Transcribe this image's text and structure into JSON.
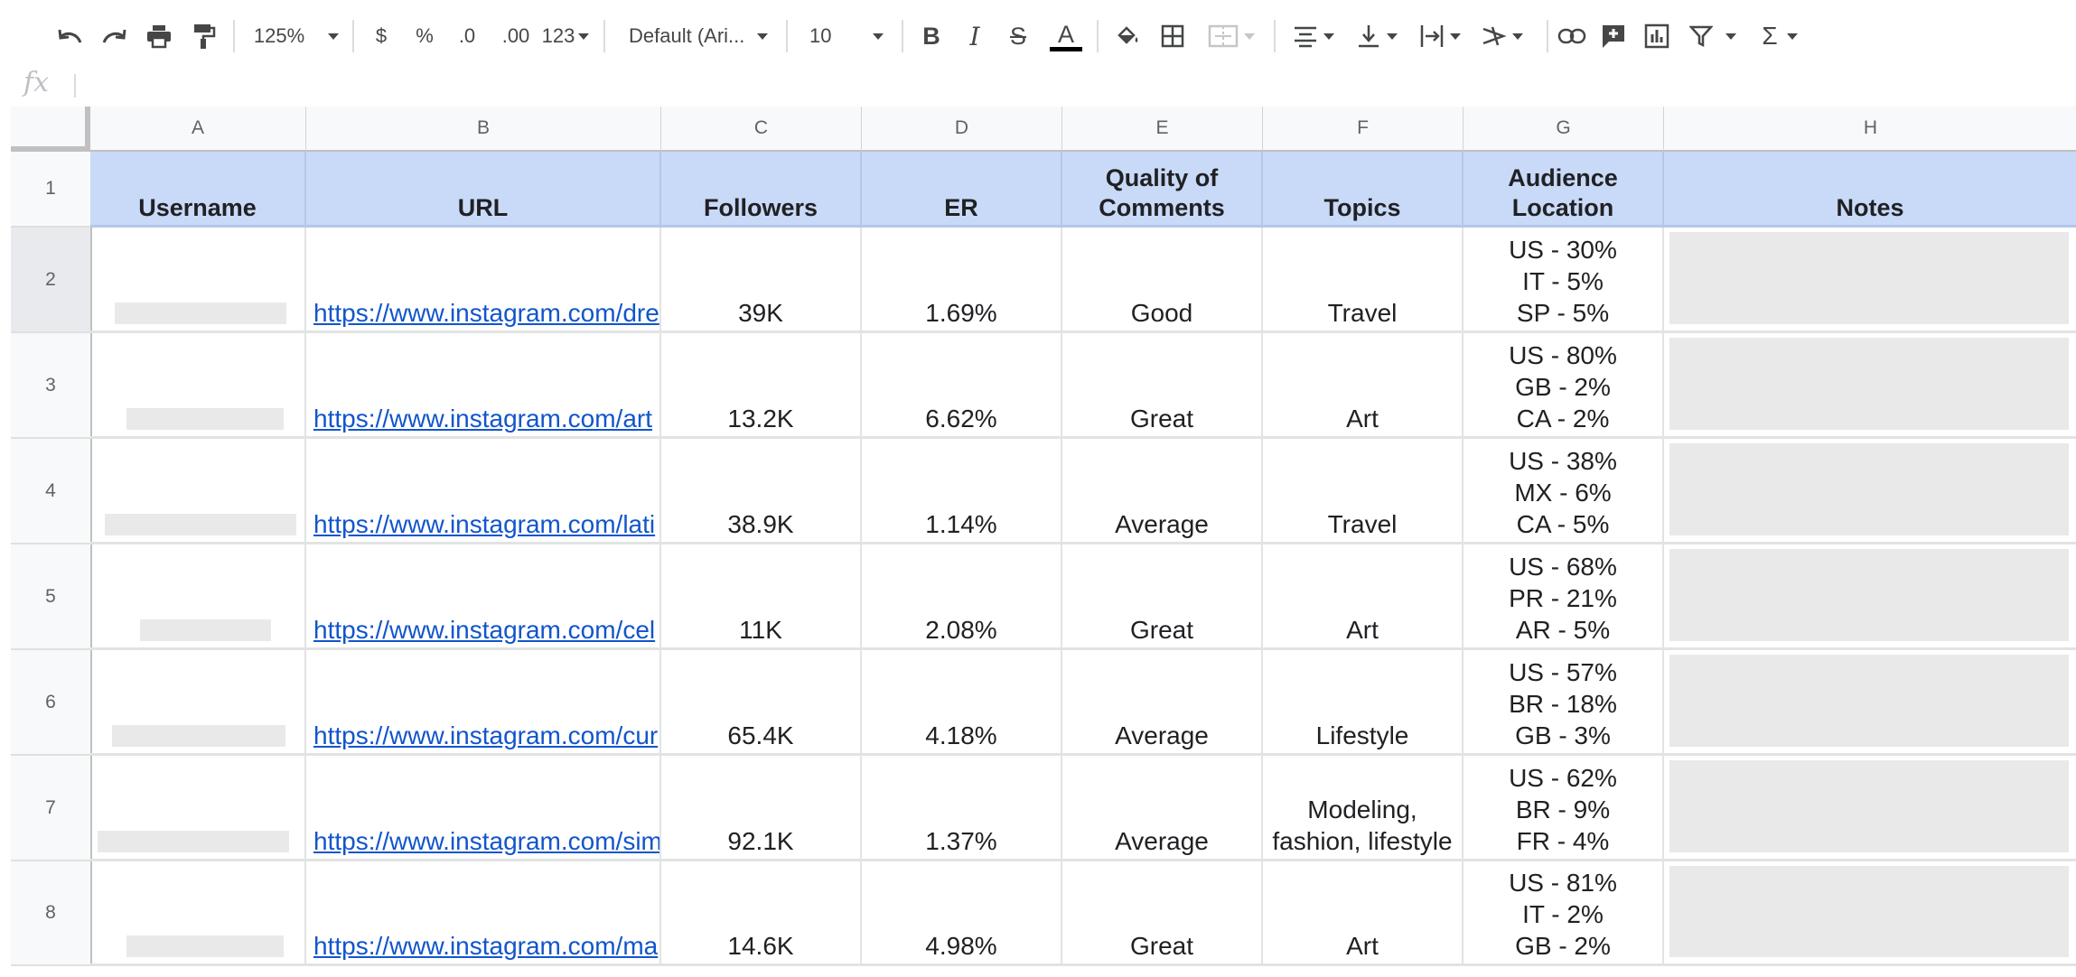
{
  "toolbar": {
    "zoom": "125%",
    "currency": "$",
    "percent": "%",
    "decrease_decimal": ".0",
    "increase_decimal": ".00",
    "number_format": "123",
    "font": "Default (Ari...",
    "font_size": "10",
    "bold": "B",
    "italic": "I",
    "strike": "S",
    "text_color": "A",
    "sum": "Σ"
  },
  "formula_bar": {
    "label": "fx"
  },
  "columns": [
    "A",
    "B",
    "C",
    "D",
    "E",
    "F",
    "G",
    "H"
  ],
  "rows": [
    "1",
    "2",
    "3",
    "4",
    "5",
    "6",
    "7",
    "8"
  ],
  "header": {
    "username": "Username",
    "url": "URL",
    "followers": "Followers",
    "er": "ER",
    "quality_line1": "Quality of",
    "quality_line2": "Comments",
    "topics": "Topics",
    "audience_line1": "Audience",
    "audience_line2": "Location",
    "notes": "Notes"
  },
  "data_rows": [
    {
      "url": "https://www.instagram.com/dre",
      "followers": "39K",
      "er": "1.69%",
      "quality": "Good",
      "topic1": "Travel",
      "topic2": "",
      "loc": [
        "US - 30%",
        "IT - 5%",
        "SP - 5%"
      ]
    },
    {
      "url": "https://www.instagram.com/art",
      "followers": "13.2K",
      "er": "6.62%",
      "quality": "Great",
      "topic1": "Art",
      "topic2": "",
      "loc": [
        "US - 80%",
        "GB - 2%",
        "CA - 2%"
      ]
    },
    {
      "url": "https://www.instagram.com/lati",
      "followers": "38.9K",
      "er": "1.14%",
      "quality": "Average",
      "topic1": "Travel",
      "topic2": "",
      "loc": [
        "US - 38%",
        "MX - 6%",
        "CA - 5%"
      ]
    },
    {
      "url": "https://www.instagram.com/cel",
      "followers": "11K",
      "er": "2.08%",
      "quality": "Great",
      "topic1": "Art",
      "topic2": "",
      "loc": [
        "US - 68%",
        "PR - 21%",
        "AR - 5%"
      ]
    },
    {
      "url": "https://www.instagram.com/cur",
      "followers": "65.4K",
      "er": "4.18%",
      "quality": "Average",
      "topic1": "Lifestyle",
      "topic2": "",
      "loc": [
        "US - 57%",
        "BR - 18%",
        "GB - 3%"
      ]
    },
    {
      "url": "https://www.instagram.com/sim",
      "followers": "92.1K",
      "er": "1.37%",
      "quality": "Average",
      "topic1": "Modeling,",
      "topic2": "fashion, lifestyle",
      "loc": [
        "US - 62%",
        "BR - 9%",
        "FR - 4%"
      ]
    },
    {
      "url": "https://www.instagram.com/ma",
      "followers": "14.6K",
      "er": "4.98%",
      "quality": "Great",
      "topic1": "Art",
      "topic2": "",
      "loc": [
        "US - 81%",
        "IT - 2%",
        "GB - 2%"
      ]
    }
  ],
  "colors": {
    "header_fill": "#c9daf8",
    "link": "#1155cc",
    "redaction": "#e9e9e9"
  }
}
